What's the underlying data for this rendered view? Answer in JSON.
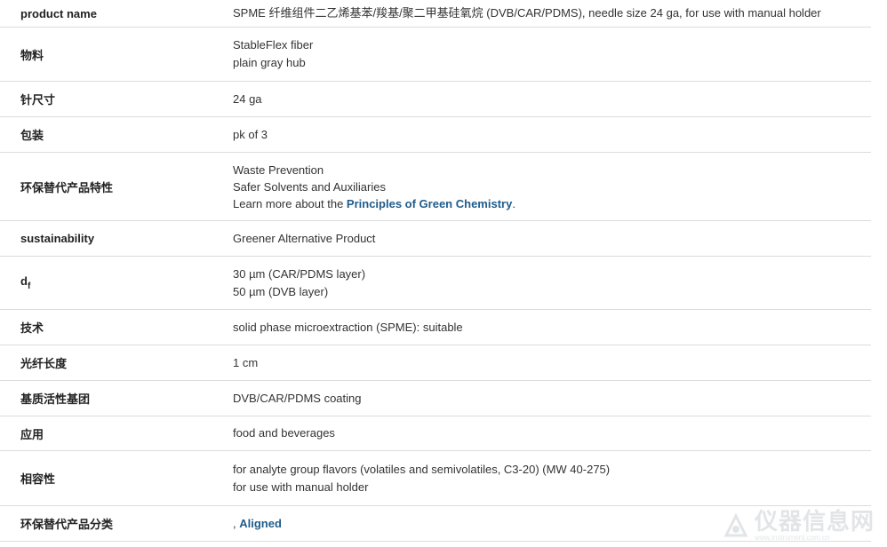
{
  "rows": [
    {
      "label": "product name",
      "lines": [
        "SPME 纤维组件二乙烯基苯/羧基/聚二甲基硅氧烷 (DVB/CAR/PDMS), needle size 24 ga, for use with manual holder"
      ]
    },
    {
      "label": "物料",
      "lines": [
        "StableFlex fiber",
        "plain gray hub"
      ]
    },
    {
      "label": "针尺寸",
      "lines": [
        "24 ga"
      ]
    },
    {
      "label": "包装",
      "lines": [
        "pk of 3"
      ]
    },
    {
      "label": "环保替代产品特性",
      "lines": [
        "Waste Prevention",
        "Safer Solvents and Auxiliaries"
      ],
      "link_prefix": "Learn more about the ",
      "link_text": "Principles of Green Chemistry",
      "link_suffix": "."
    },
    {
      "label": "sustainability",
      "lines": [
        "Greener Alternative Product"
      ]
    },
    {
      "label_main": "d",
      "label_sub": "f",
      "lines": [
        "30 µm (CAR/PDMS layer)",
        "50 µm (DVB layer)"
      ]
    },
    {
      "label": "技术",
      "lines": [
        "solid phase microextraction (SPME): suitable"
      ]
    },
    {
      "label": "光纤长度",
      "lines": [
        "1 cm"
      ]
    },
    {
      "label": "基质活性基团",
      "lines": [
        "DVB/CAR/PDMS coating"
      ]
    },
    {
      "label": "应用",
      "lines": [
        "food and beverages"
      ]
    },
    {
      "label": "相容性",
      "lines": [
        "for analyte group flavors (volatiles and semivolatiles, C3-20) (MW 40-275)",
        "for use with manual holder"
      ]
    },
    {
      "label": "环保替代产品分类",
      "prefix": ", ",
      "link_text": "Aligned"
    }
  ],
  "watermark": {
    "text": "仪器信息网",
    "url": "www.instrument.com.cn",
    "icon": "instrument-logo-icon"
  }
}
